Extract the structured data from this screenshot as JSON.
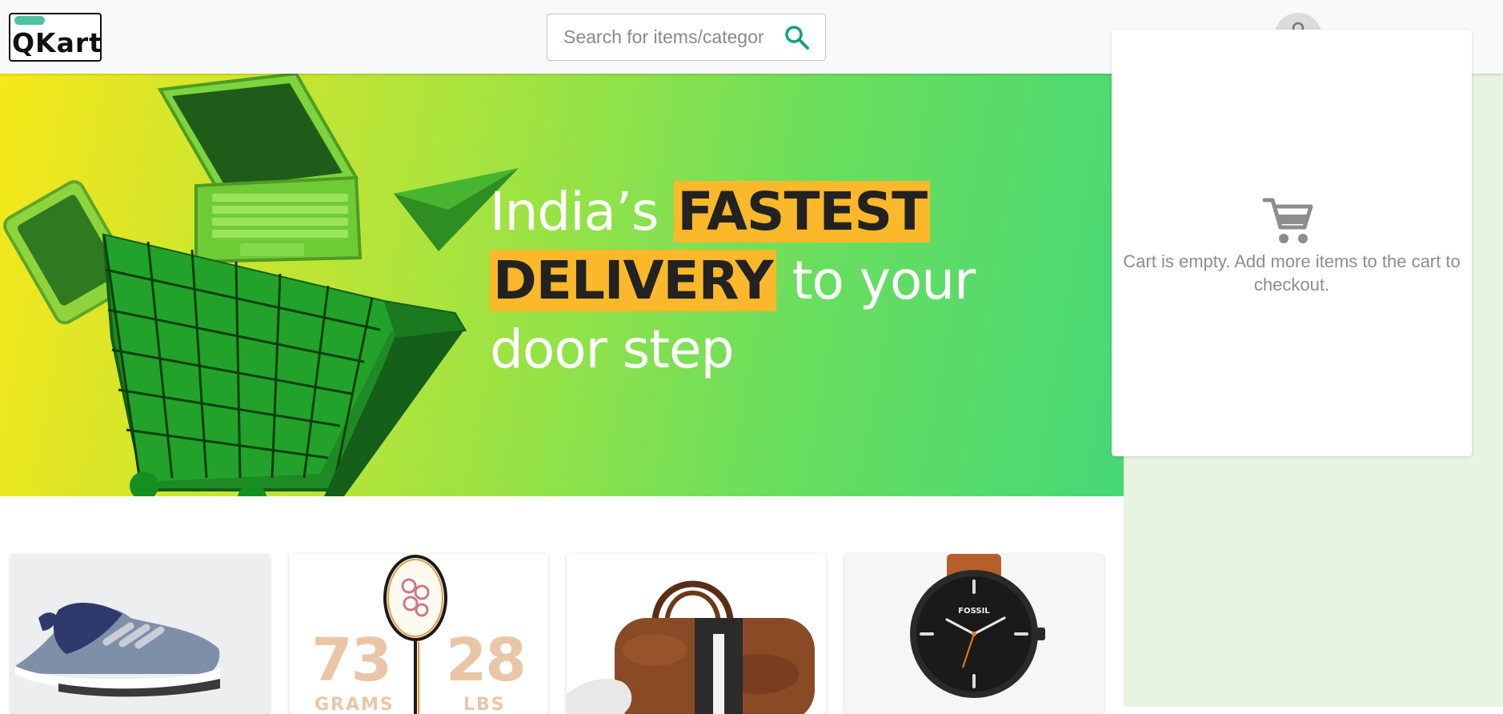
{
  "header": {
    "logo_text": "QKart",
    "search": {
      "placeholder": "Search for items/categor",
      "value": ""
    },
    "search_icon": "search-icon",
    "avatar_icon": "user-avatar-icon"
  },
  "hero": {
    "headline_part1": "India’s ",
    "highlight1": "FASTEST",
    "highlight2": "DELIVERY",
    "headline_part2": " to your door step",
    "accent_color": "#fbb82a"
  },
  "cart": {
    "icon": "shopping-cart-icon",
    "empty_message": "Cart is empty. Add more items to the cart to checkout."
  },
  "products": {
    "racket": {
      "left_number": "73",
      "left_unit": "GRAMS",
      "right_number": "28",
      "right_unit": "LBS"
    },
    "watch": {
      "brand": "FOSSIL"
    }
  },
  "colors": {
    "header_bg": "#f8f9fa",
    "sidebar_bg": "#e8f4e0",
    "brand_green": "#4fc3a0"
  }
}
